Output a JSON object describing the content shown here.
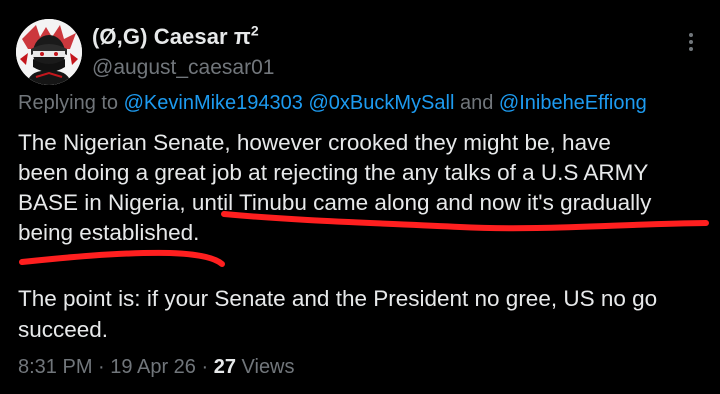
{
  "author": {
    "display_name": "(Ø,G) Caesar π",
    "display_name_superscript": "2",
    "handle": "@august_caesar01",
    "avatar_icon": "avatar-ninja-mask-icon"
  },
  "reply": {
    "prefix": "Replying to",
    "mentions": [
      "@KevinMike194303",
      "@0xBuckMySall",
      "@InibeheEffiong"
    ],
    "conjunction": "and"
  },
  "content": {
    "lines": [
      "The Nigerian Senate, however crooked they might be, have",
      "been doing a great job at rejecting the any talks of a U.S ARMY",
      "BASE in Nigeria, until Tinubu came along and now it's gradually",
      "being established."
    ],
    "paragraph2_lines": [
      "The point is: if your Senate and the President no gree, US no go",
      "succeed."
    ]
  },
  "meta": {
    "time": "8:31 PM",
    "separator": "·",
    "date": "19 Apr 26",
    "views_count": "27",
    "views_label": "Views"
  },
  "colors": {
    "background": "#000000",
    "text": "#e7e9ea",
    "muted": "#71767b",
    "link": "#1d9bf0",
    "annotation": "#ff1f1f"
  }
}
